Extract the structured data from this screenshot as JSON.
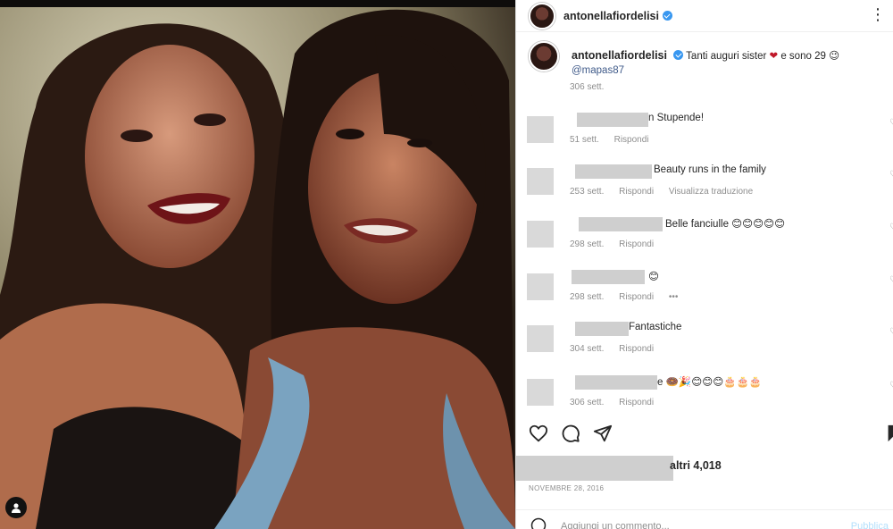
{
  "post": {
    "image_alt": "",
    "username": "antonellafiordelisi",
    "more_icon": "more-icon"
  },
  "caption": {
    "username": "antonellafiordelisi",
    "text_before": "Tanti auguri sister",
    "text_after": "e sono 29",
    "mention": "@mapas87",
    "time": "306 sett."
  },
  "comments": [
    {
      "text": "n Stupende!",
      "time": "51 sett.",
      "reply": "Rispondi",
      "extra": ""
    },
    {
      "text": "Beauty runs in the family",
      "time": "253 sett.",
      "reply": "Rispondi",
      "extra": "Visualizza traduzione"
    },
    {
      "text": "Belle fanciulle 😊😊😊😊😊",
      "time": "298 sett.",
      "reply": "Rispondi",
      "extra": ""
    },
    {
      "text": "😊",
      "time": "298 sett.",
      "reply": "Rispondi",
      "extra": "•••"
    },
    {
      "text": "Fantastiche",
      "time": "304 sett.",
      "reply": "Rispondi",
      "extra": ""
    },
    {
      "text": "e 🍩🎉😊😊😊🎂🎂🎂",
      "time": "306 sett.",
      "reply": "Rispondi",
      "extra": ""
    }
  ],
  "likes": {
    "label": "altri 4,018"
  },
  "date": "NOVEMBRE 28, 2016",
  "add_comment": {
    "placeholder": "Aggiungi un commento...",
    "publish": "Pubblica"
  }
}
